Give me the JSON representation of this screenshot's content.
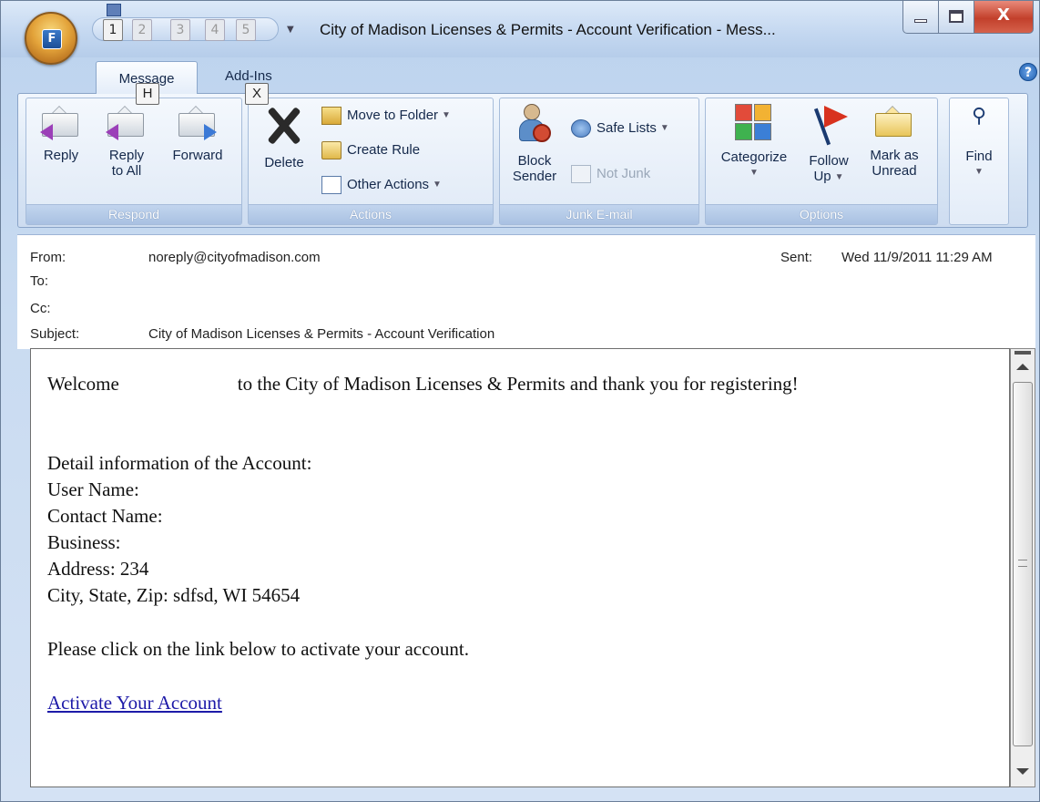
{
  "window": {
    "title": "City of Madison Licenses & Permits - Account Verification - Mess...",
    "office_button_letter": "F",
    "qat_keytips": [
      "1",
      "2",
      "3",
      "4",
      "5"
    ],
    "close_glyph": "X"
  },
  "tabs": [
    {
      "label": "Message",
      "keytip": "H"
    },
    {
      "label": "Add-Ins",
      "keytip": "X"
    }
  ],
  "help_glyph": "?",
  "ribbon": {
    "respond": {
      "label": "Respond",
      "reply": "Reply",
      "reply_all_line1": "Reply",
      "reply_all_line2": "to All",
      "forward": "Forward"
    },
    "actions": {
      "label": "Actions",
      "delete": "Delete",
      "move_to_folder": "Move to Folder",
      "create_rule": "Create Rule",
      "other_actions": "Other Actions"
    },
    "junk": {
      "label": "Junk E-mail",
      "block_sender_line1": "Block",
      "block_sender_line2": "Sender",
      "safe_lists": "Safe Lists",
      "not_junk": "Not Junk"
    },
    "options": {
      "label": "Options",
      "categorize": "Categorize",
      "follow_up_line1": "Follow",
      "follow_up_line2": "Up",
      "mark_unread_line1": "Mark as",
      "mark_unread_line2": "Unread"
    },
    "find": {
      "label": "Find"
    }
  },
  "header": {
    "from_label": "From:",
    "from_value": "noreply@cityofmadison.com",
    "to_label": "To:",
    "cc_label": "Cc:",
    "subject_label": "Subject:",
    "subject_value": "City of Madison Licenses & Permits - Account Verification",
    "sent_label": "Sent:",
    "sent_value": "Wed 11/9/2011 11:29 AM"
  },
  "body": {
    "welcome_prefix": "Welcome",
    "welcome_suffix": "to the City of Madison Licenses & Permits and thank you for registering!",
    "detail_heading": "Detail information of the Account:",
    "user_name": "User Name:",
    "contact_name": "Contact Name:",
    "business": "Business:",
    "address": "Address: 234",
    "city_state_zip": "City, State, Zip:  sdfsd, WI 54654",
    "instruction": "Please click on the link below to activate your account.",
    "link_text": "Activate Your Account"
  },
  "colors": {
    "link": "#1d1aa8",
    "ribbon_accent": "#a9c1e2",
    "close_button": "#c2402b"
  }
}
